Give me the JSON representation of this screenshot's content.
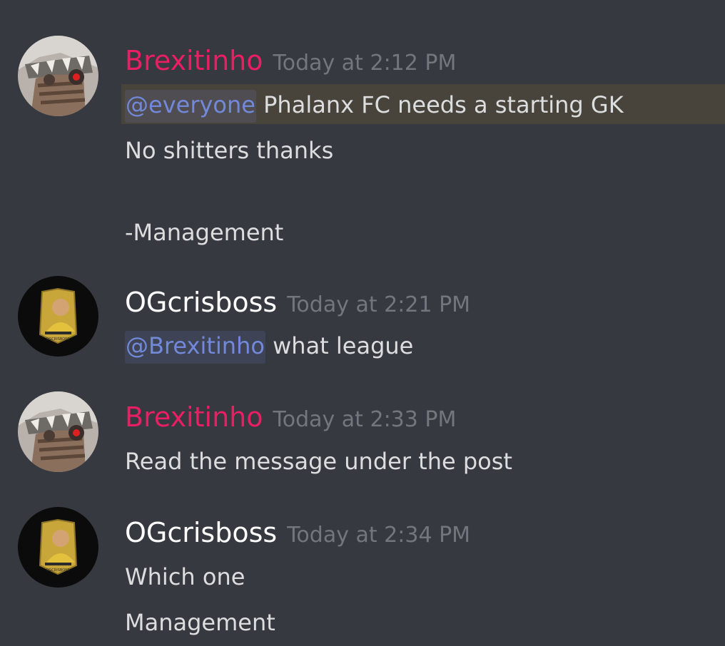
{
  "colors": {
    "background": "#36393f",
    "brexit_name": "#e91e63",
    "og_name": "#ffffff",
    "text": "#dcddde",
    "timestamp": "#72767d",
    "mention": "#7289da"
  },
  "messages": [
    {
      "username": "Brexitinho",
      "timestamp": "Today at 2:12 PM",
      "mention": "@everyone",
      "lines": [
        "Phalanx FC needs a starting GK",
        "No shitters thanks",
        "-Management"
      ]
    },
    {
      "username": "OGcrisboss",
      "timestamp": "Today at 2:21 PM",
      "mention": "@Brexitinho",
      "lines": [
        "what league"
      ]
    },
    {
      "username": "Brexitinho",
      "timestamp": "Today at 2:33 PM",
      "lines": [
        "Read the message under the post"
      ]
    },
    {
      "username": "OGcrisboss",
      "timestamp": "Today at 2:34 PM",
      "lines": [
        "Which one",
        "Management"
      ]
    }
  ]
}
